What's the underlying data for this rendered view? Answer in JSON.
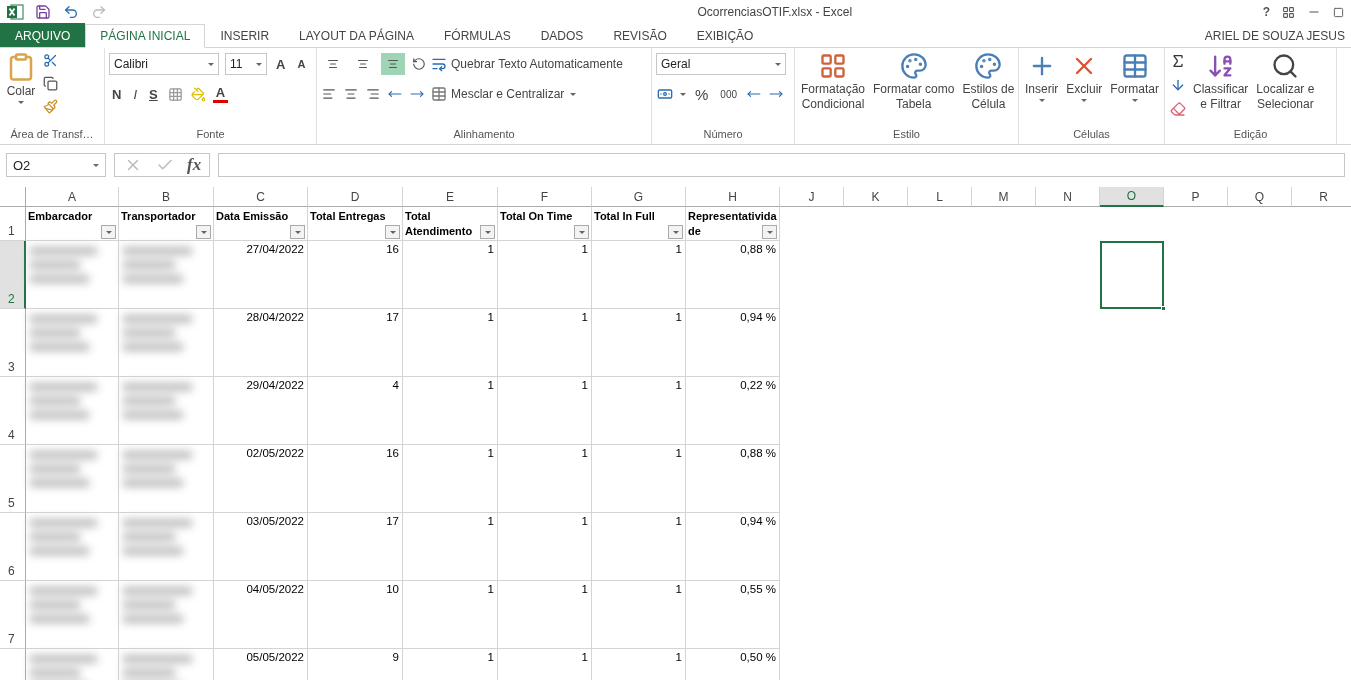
{
  "title": "OcorrenciasOTIF.xlsx - Excel",
  "window_controls": {
    "help": "?"
  },
  "tabs": [
    {
      "label": "ARQUIVO",
      "kind": "file",
      "selected": false
    },
    {
      "label": "PÁGINA INICIAL",
      "kind": "tab",
      "selected": true
    },
    {
      "label": "INSERIR",
      "kind": "tab",
      "selected": false
    },
    {
      "label": "LAYOUT DA PÁGINA",
      "kind": "tab",
      "selected": false
    },
    {
      "label": "FÓRMULAS",
      "kind": "tab",
      "selected": false
    },
    {
      "label": "DADOS",
      "kind": "tab",
      "selected": false
    },
    {
      "label": "REVISÃO",
      "kind": "tab",
      "selected": false
    },
    {
      "label": "EXIBIÇÃO",
      "kind": "tab",
      "selected": false
    }
  ],
  "user": "ARIEL DE SOUZA JESUS",
  "ribbon": {
    "clipboard": {
      "label": "Área de Transf…",
      "paste": "Colar"
    },
    "font": {
      "label": "Fonte",
      "font_name": "Calibri",
      "font_size": "11",
      "grow": "A",
      "shrink": "A",
      "bold": "N",
      "italic": "I",
      "underline": "S",
      "font_color": "A"
    },
    "alignment": {
      "label": "Alinhamento",
      "wrap": "Quebrar Texto Automaticamente",
      "merge": "Mesclar e Centralizar",
      "bottom_align_selected": true
    },
    "number": {
      "label": "Número",
      "format": "Geral",
      "percent": "%",
      "thousands": "000"
    },
    "styles": {
      "label": "Estilo",
      "buttons": [
        {
          "lines": [
            "Formatação",
            "Condicional"
          ]
        },
        {
          "lines": [
            "Formatar como",
            "Tabela"
          ]
        },
        {
          "lines": [
            "Estilos de",
            "Célula"
          ]
        }
      ]
    },
    "cells": {
      "label": "Células",
      "buttons": [
        "Inserir",
        "Excluir",
        "Formatar"
      ]
    },
    "editing": {
      "label": "Edição",
      "buttons": [
        {
          "lines": [
            "Classificar",
            "e Filtrar"
          ]
        },
        {
          "lines": [
            "Localizar e",
            "Selecionar"
          ]
        }
      ]
    }
  },
  "formula_bar": {
    "name_box": "O2",
    "function_label": "fx"
  },
  "sheet": {
    "columns": [
      {
        "letter": "A",
        "selected": false
      },
      {
        "letter": "B",
        "selected": false
      },
      {
        "letter": "C",
        "selected": false
      },
      {
        "letter": "D",
        "selected": false
      },
      {
        "letter": "E",
        "selected": false
      },
      {
        "letter": "F",
        "selected": false
      },
      {
        "letter": "G",
        "selected": false
      },
      {
        "letter": "H",
        "selected": false
      },
      {
        "letter": "J",
        "selected": false
      },
      {
        "letter": "K",
        "selected": false
      },
      {
        "letter": "L",
        "selected": false
      },
      {
        "letter": "M",
        "selected": false
      },
      {
        "letter": "N",
        "selected": false
      },
      {
        "letter": "O",
        "selected": true
      },
      {
        "letter": "P",
        "selected": false
      },
      {
        "letter": "Q",
        "selected": false
      },
      {
        "letter": "R",
        "selected": false
      }
    ],
    "header_row": {
      "number": "1",
      "selected": false,
      "cells": [
        "Embarcador",
        "Transportador",
        "Data Emissão",
        "Total Entregas",
        "Total Atendimento",
        "Total On Time",
        "Total In Full",
        "Representatividade"
      ]
    },
    "rows": [
      {
        "number": "2",
        "selected": true,
        "redacted": true,
        "cells": [
          "",
          "",
          "27/04/2022",
          "16",
          "1",
          "1",
          "1",
          "0,88 %"
        ]
      },
      {
        "number": "3",
        "selected": false,
        "redacted": true,
        "cells": [
          "",
          "",
          "28/04/2022",
          "17",
          "1",
          "1",
          "1",
          "0,94 %"
        ]
      },
      {
        "number": "4",
        "selected": false,
        "redacted": true,
        "cells": [
          "",
          "",
          "29/04/2022",
          "4",
          "1",
          "1",
          "1",
          "0,22 %"
        ]
      },
      {
        "number": "5",
        "selected": false,
        "redacted": true,
        "cells": [
          "",
          "",
          "02/05/2022",
          "16",
          "1",
          "1",
          "1",
          "0,88 %"
        ]
      },
      {
        "number": "6",
        "selected": false,
        "redacted": true,
        "cells": [
          "",
          "",
          "03/05/2022",
          "17",
          "1",
          "1",
          "1",
          "0,94 %"
        ]
      },
      {
        "number": "7",
        "selected": false,
        "redacted": true,
        "cells": [
          "",
          "",
          "04/05/2022",
          "10",
          "1",
          "1",
          "1",
          "0,55 %"
        ]
      },
      {
        "selected": false,
        "redacted": true,
        "cells": [
          "",
          "",
          "05/05/2022",
          "9",
          "1",
          "1",
          "1",
          "0,50 %"
        ]
      }
    ]
  }
}
